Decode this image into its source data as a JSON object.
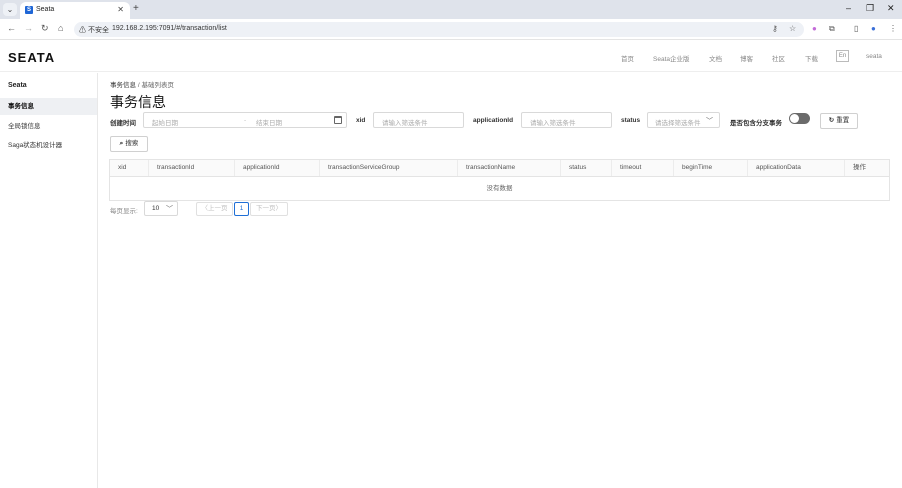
{
  "browser": {
    "tab_title": "Seata",
    "url_warning": "不安全",
    "url": "192.168.2.195:7091/#/transaction/list"
  },
  "header": {
    "logo": "SEATA",
    "nav": [
      "首页",
      "Seata企业版",
      "文档",
      "博客",
      "社区",
      "下载"
    ],
    "lang": "En",
    "brand_text": "seata"
  },
  "sidebar": {
    "title": "Seata",
    "items": [
      {
        "label": "事务信息",
        "active": true
      },
      {
        "label": "全局锁信息",
        "active": false
      },
      {
        "label": "Saga状态机设计器",
        "active": false
      }
    ]
  },
  "breadcrumb": {
    "first": "事务信息",
    "separator": "/",
    "second": "基础列表页"
  },
  "page_title": "事务信息",
  "filters": {
    "create_time_label": "创建时间",
    "start_date_placeholder": "起始日期",
    "date_separator": "-",
    "end_date_placeholder": "结束日期",
    "xid_label": "xid",
    "xid_placeholder": "请输入筛选条件",
    "application_label": "applicationId",
    "application_placeholder": "请输入筛选条件",
    "status_label": "status",
    "status_placeholder": "请选择筛选条件",
    "include_branch_label": "是否包含分支事务",
    "include_branch_on": false,
    "reset_label": "重置",
    "search_label": "搜索"
  },
  "table": {
    "columns": [
      "xid",
      "transactionId",
      "applicationId",
      "transactionServiceGroup",
      "transactionName",
      "status",
      "timeout",
      "beginTime",
      "applicationData",
      "操作"
    ],
    "empty_text": "没有数据"
  },
  "pagination": {
    "page_size_label": "每页显示:",
    "page_size": "10",
    "prev_label": "上一页",
    "current_page": "1",
    "next_label": "下一页"
  }
}
